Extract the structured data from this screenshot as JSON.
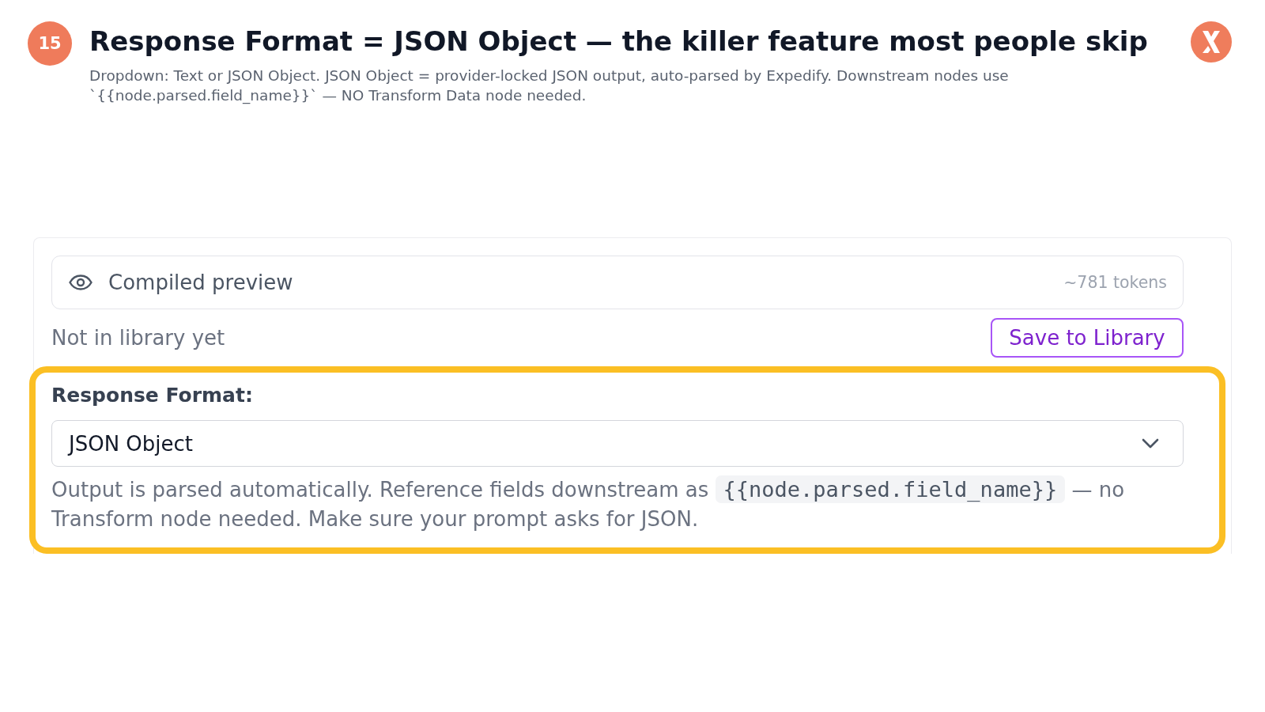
{
  "slide": {
    "number": "15",
    "title": "Response Format = JSON Object — the killer feature most people skip",
    "subtitle": "Dropdown: Text or JSON Object. JSON Object = provider-locked JSON output, auto-parsed by Expedify. Downstream nodes use `{{node.parsed.field_name}}` — NO Transform Data node needed."
  },
  "panel": {
    "preview": {
      "label": "Compiled preview",
      "tokens": "~781 tokens"
    },
    "library_status": "Not in library yet",
    "save_button": "Save to Library",
    "response_format": {
      "highlighted": true,
      "label": "Response Format:",
      "value": "JSON Object",
      "help_parts": [
        {
          "kind": "text",
          "text": "Output is parsed automatically. Reference fields downstream as "
        },
        {
          "kind": "code",
          "text": "{{node.parsed.field_name}}"
        },
        {
          "kind": "text",
          "text": " — no Transform node needed. Make sure your prompt asks for JSON."
        }
      ]
    }
  }
}
